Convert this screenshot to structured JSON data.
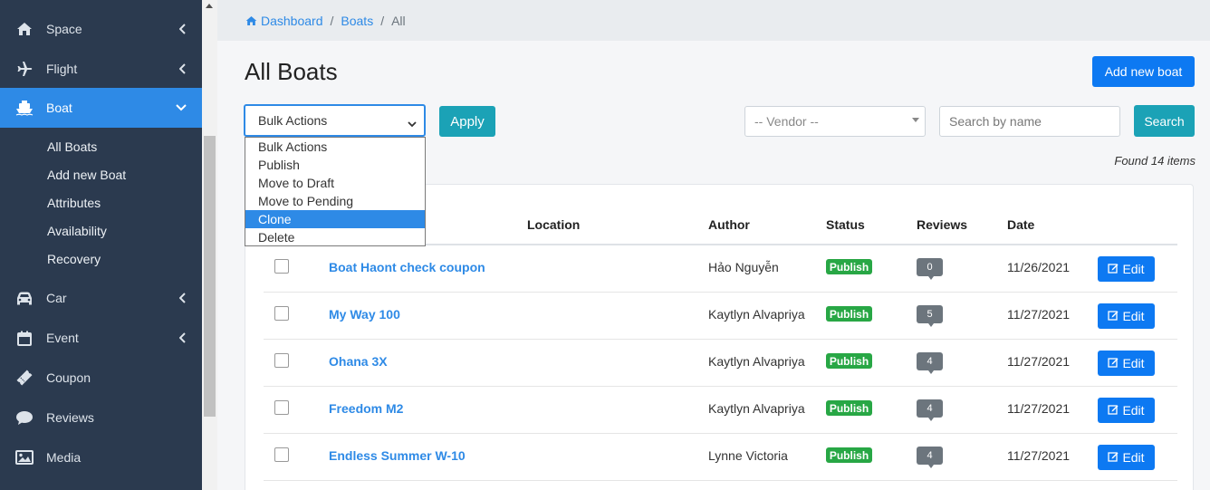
{
  "sidebar": {
    "items": [
      {
        "label": "Space",
        "icon": "home-icon"
      },
      {
        "label": "Flight",
        "icon": "plane-icon"
      },
      {
        "label": "Boat",
        "icon": "ship-icon"
      },
      {
        "label": "Car",
        "icon": "car-icon"
      },
      {
        "label": "Event",
        "icon": "calendar-icon"
      },
      {
        "label": "Coupon",
        "icon": "ticket-icon"
      },
      {
        "label": "Reviews",
        "icon": "comment-icon"
      },
      {
        "label": "Media",
        "icon": "image-icon"
      }
    ],
    "boat_submenu": [
      "All Boats",
      "Add new Boat",
      "Attributes",
      "Availability",
      "Recovery"
    ]
  },
  "breadcrumb": {
    "dashboard": "Dashboard",
    "boats": "Boats",
    "current": "All"
  },
  "page_title": "All Boats",
  "add_new_label": "Add new boat",
  "bulk": {
    "selected": "Bulk Actions",
    "options": [
      "Bulk Actions",
      "Publish",
      "Move to Draft",
      "Move to Pending",
      "Clone",
      "Delete"
    ],
    "highlighted": "Clone",
    "apply_label": "Apply"
  },
  "vendor_select": "-- Vendor --",
  "search": {
    "placeholder": "Search by name",
    "button_label": "Search"
  },
  "found_text": "Found 14 items",
  "table": {
    "headers": {
      "location": "Location",
      "author": "Author",
      "status": "Status",
      "reviews": "Reviews",
      "date": "Date"
    },
    "rows": [
      {
        "title": "Boat Haont check coupon",
        "author": "Hảo Nguyễn",
        "status": "Publish",
        "reviews": "0",
        "date": "11/26/2021"
      },
      {
        "title": "My Way 100",
        "author": "Kaytlyn Alvapriya",
        "status": "Publish",
        "reviews": "5",
        "date": "11/27/2021"
      },
      {
        "title": "Ohana 3X",
        "author": "Kaytlyn Alvapriya",
        "status": "Publish",
        "reviews": "4",
        "date": "11/27/2021"
      },
      {
        "title": "Freedom M2",
        "author": "Kaytlyn Alvapriya",
        "status": "Publish",
        "reviews": "4",
        "date": "11/27/2021"
      },
      {
        "title": "Endless Summer W-10",
        "author": "Lynne Victoria",
        "status": "Publish",
        "reviews": "4",
        "date": "11/27/2021"
      }
    ],
    "edit_label": "Edit"
  },
  "colors": {
    "sidebar_bg": "#2b3a4f",
    "accent": "#2e8ae6",
    "primary_button": "#0d79f2",
    "info_button": "#1ba2b6",
    "publish_badge": "#28a745",
    "review_badge": "#6c757d"
  }
}
